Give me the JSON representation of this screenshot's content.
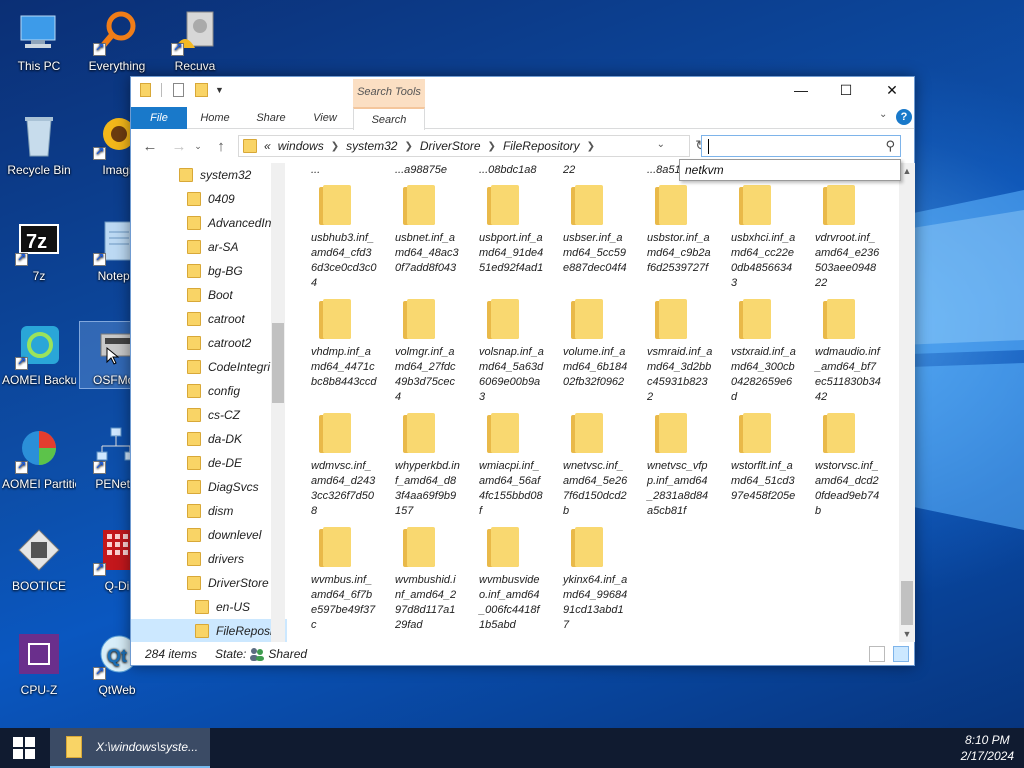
{
  "desktop": {
    "icons": [
      {
        "label": "This PC"
      },
      {
        "label": "Everything"
      },
      {
        "label": "Recuva"
      },
      {
        "label": "Recycle Bin"
      },
      {
        "label": "Imagi"
      },
      {
        "label": "7z"
      },
      {
        "label": "Notepa"
      },
      {
        "label": "AOMEI Backupper"
      },
      {
        "label": "OSFMou"
      },
      {
        "label": "AOMEI Partitio..."
      },
      {
        "label": "PENetw"
      },
      {
        "label": "BOOTICE"
      },
      {
        "label": "Q-Di"
      },
      {
        "label": "CPU-Z"
      },
      {
        "label": "QtWeb"
      }
    ]
  },
  "explorer": {
    "context_tab_header": "Search Tools",
    "tabs": {
      "file": "File",
      "home": "Home",
      "share": "Share",
      "view": "View",
      "search": "Search"
    },
    "address": {
      "overflow": "«",
      "crumbs": [
        "windows",
        "system32",
        "DriverStore",
        "FileRepository"
      ]
    },
    "search": {
      "value": "",
      "suggestion": "netkvm"
    },
    "tree": [
      {
        "label": "system32"
      },
      {
        "label": "0409"
      },
      {
        "label": "AdvancedIn"
      },
      {
        "label": "ar-SA"
      },
      {
        "label": "bg-BG"
      },
      {
        "label": "Boot"
      },
      {
        "label": "catroot"
      },
      {
        "label": "catroot2"
      },
      {
        "label": "CodeIntegri"
      },
      {
        "label": "config"
      },
      {
        "label": "cs-CZ"
      },
      {
        "label": "da-DK"
      },
      {
        "label": "de-DE"
      },
      {
        "label": "DiagSvcs"
      },
      {
        "label": "dism"
      },
      {
        "label": "downlevel"
      },
      {
        "label": "drivers"
      },
      {
        "label": "DriverStore"
      },
      {
        "label": "en-US"
      },
      {
        "label": "FileReposi"
      }
    ],
    "clipped_row": [
      "...",
      "...a98875e",
      "...08bdc1a8",
      "22",
      "...8a51",
      ""
    ],
    "files": [
      {
        "name": "usbhub3.inf_amd64_cfd36d3ce0cd3c04"
      },
      {
        "name": "usbnet.inf_amd64_48ac30f7add8f043"
      },
      {
        "name": "usbport.inf_amd64_91de451ed92f4ad1"
      },
      {
        "name": "usbser.inf_amd64_5cc59e887dec04f4"
      },
      {
        "name": "usbstor.inf_amd64_c9b2af6d2539727f"
      },
      {
        "name": "usbxhci.inf_amd64_cc22e0db48566343"
      },
      {
        "name": "vdrvroot.inf_amd64_e236503aee094822"
      },
      {
        "name": "vhdmp.inf_amd64_4471cbc8b8443ccd"
      },
      {
        "name": "volmgr.inf_amd64_27fdc49b3d75cec4"
      },
      {
        "name": "volsnap.inf_amd64_5a63d6069e00b9a3"
      },
      {
        "name": "volume.inf_amd64_6b18402fb32f0962"
      },
      {
        "name": "vsmraid.inf_amd64_3d2bbc45931b8232"
      },
      {
        "name": "vstxraid.inf_amd64_300cb04282659e6d"
      },
      {
        "name": "wdmaudio.inf_amd64_bf7ec511830b3442"
      },
      {
        "name": "wdmvsc.inf_amd64_d2433cc326f7d508"
      },
      {
        "name": "whyperkbd.inf_amd64_d83f4aa69f9b9157"
      },
      {
        "name": "wmiacpi.inf_amd64_56af4fc155bbd08f"
      },
      {
        "name": "wnetvsc.inf_amd64_5e267f6d150dcd2b"
      },
      {
        "name": "wnetvsc_vfpp.inf_amd64_2831a8d84a5cb81f"
      },
      {
        "name": "wstorflt.inf_amd64_51cd397e458f205e"
      },
      {
        "name": "wstorvsc.inf_amd64_dcd20fdead9eb74b"
      },
      {
        "name": "wvmbus.inf_amd64_6f7be597be49f37c"
      },
      {
        "name": "wvmbushid.inf_amd64_297d8d117a129fad"
      },
      {
        "name": "wvmbusvideo.inf_amd64_006fc4418f1b5abd"
      },
      {
        "name": "ykinx64.inf_amd64_9968491cd13abd17"
      }
    ],
    "status": {
      "count": "284 items",
      "state_label": "State:",
      "state_value": "Shared"
    }
  },
  "taskbar": {
    "window_label": "X:\\windows\\syste...",
    "time": "8:10 PM",
    "date": "2/17/2024"
  },
  "colors": {
    "accent": "#1979ca",
    "selection": "#cce8ff",
    "folder": "#f9d466",
    "taskbar": "#101b30"
  }
}
